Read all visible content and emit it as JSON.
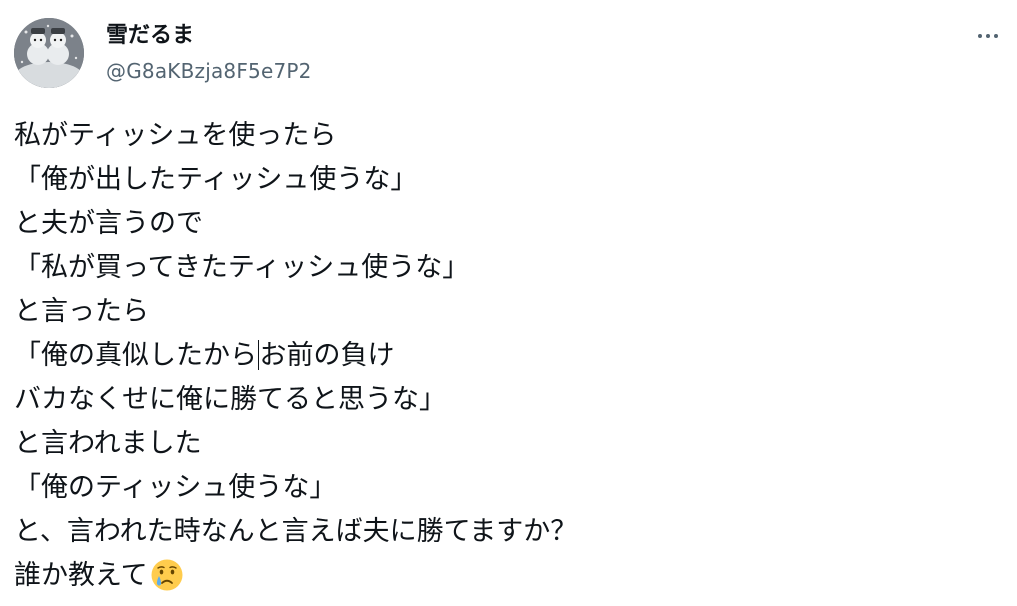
{
  "post": {
    "author": {
      "display_name": "雪だるま",
      "handle": "@G8aKBzja8F5e7P2",
      "avatar_icon": "snowman-avatar"
    },
    "more_icon": "more-horizontal-icon",
    "text_lines": [
      "私がティッシュを使ったら",
      "「俺が出したティッシュ使うな」",
      "と夫が言うので",
      "「私が買ってきたティッシュ使うな」",
      "と言ったら",
      "「俺の真似したから",
      "お前の負け",
      "バカなくせに俺に勝てると思うな」",
      "と言われました",
      "「俺のティッシュ使うな」",
      "と、言われた時なんと言えば夫に勝てますか？",
      "誰か教えて"
    ],
    "final_emoji": "crying-face-emoji"
  }
}
